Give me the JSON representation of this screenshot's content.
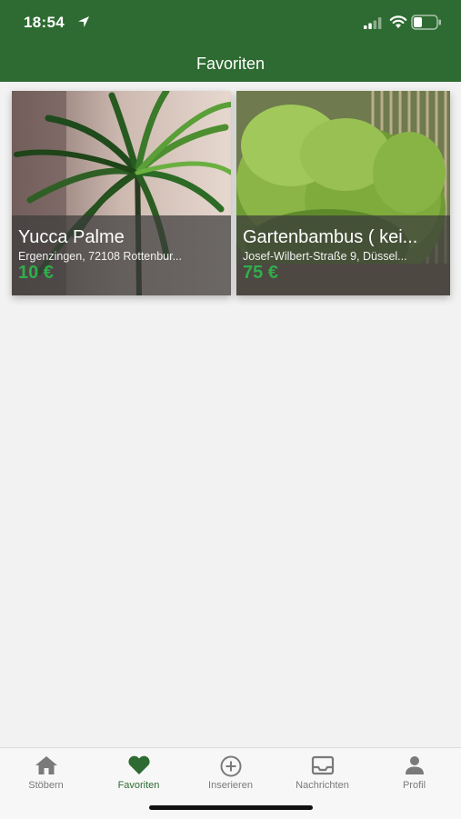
{
  "status": {
    "time": "18:54"
  },
  "header": {
    "title": "Favoriten"
  },
  "listings": [
    {
      "title": "Yucca Palme",
      "location": "Ergenzingen, 72108 Rottenbur...",
      "price": "10 €"
    },
    {
      "title": "Gartenbambus ( kei...",
      "location": "Josef-Wilbert-Straße 9, Düssel...",
      "price": "75 €"
    }
  ],
  "tabs": [
    {
      "label": "Stöbern",
      "icon": "home-icon"
    },
    {
      "label": "Favoriten",
      "icon": "heart-icon",
      "active": true
    },
    {
      "label": "Inserieren",
      "icon": "plus-circle-icon"
    },
    {
      "label": "Nachrichten",
      "icon": "inbox-icon"
    },
    {
      "label": "Profil",
      "icon": "person-icon"
    }
  ],
  "colors": {
    "brand": "#2e6b32",
    "price": "#2fae4a",
    "background": "#f2f2f2"
  }
}
